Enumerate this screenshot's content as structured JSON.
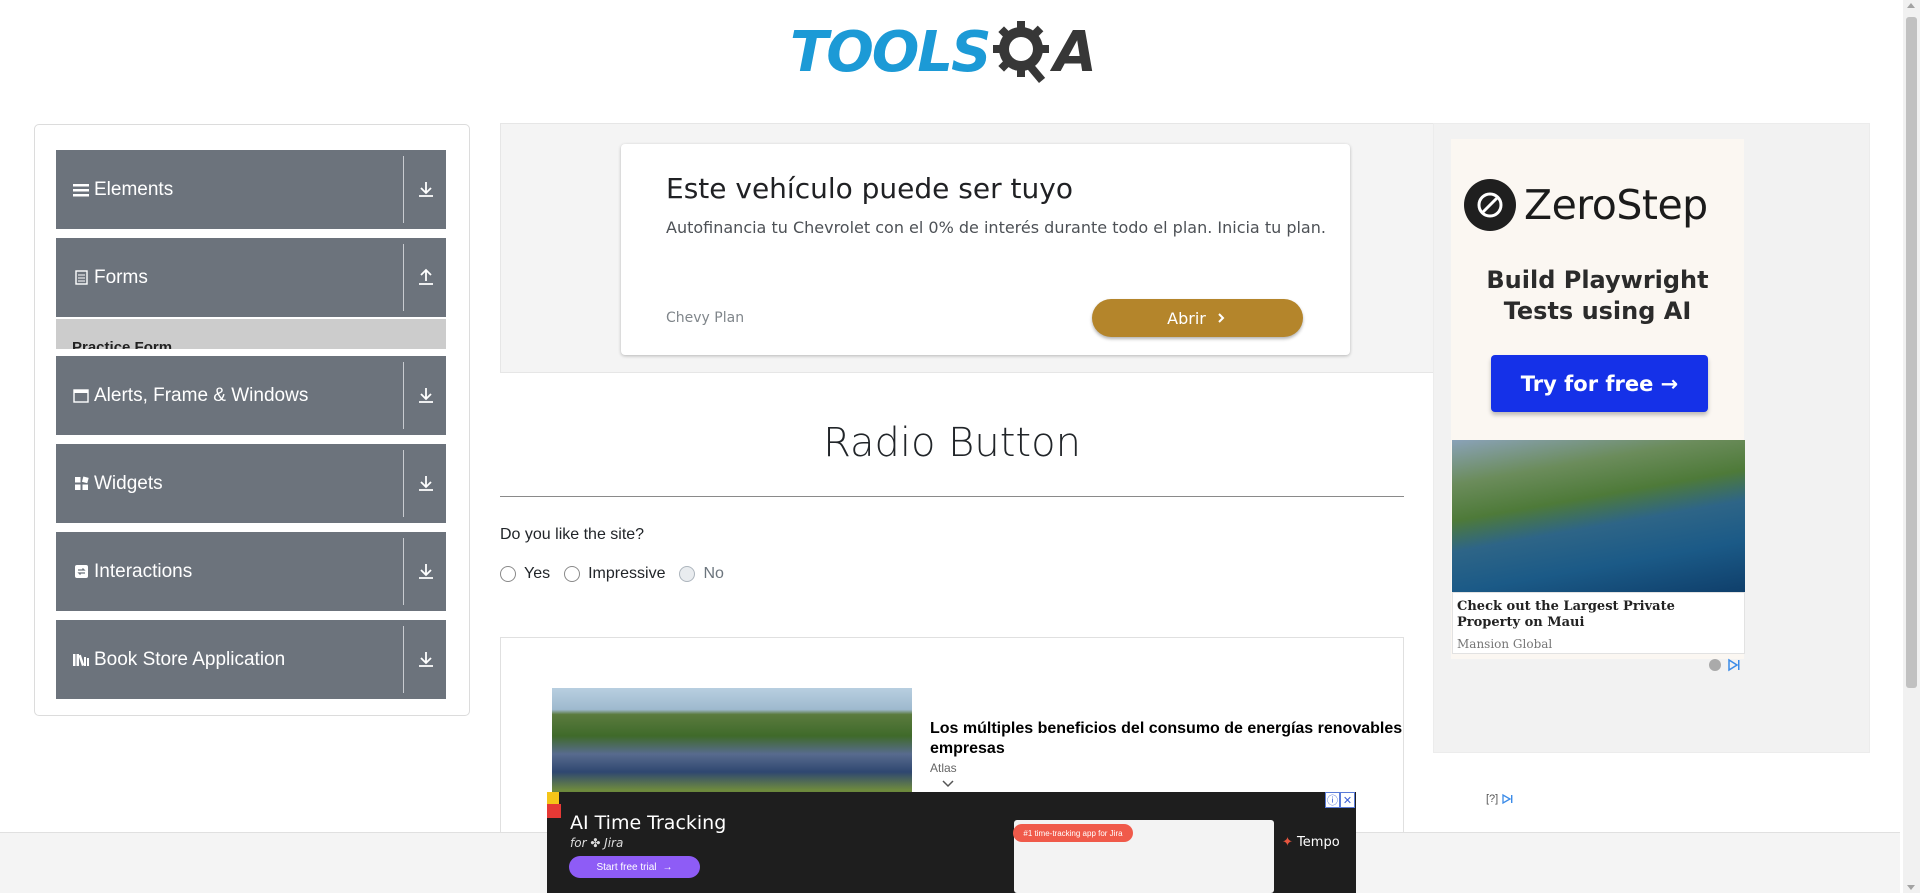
{
  "header": {
    "logo_part1": "TOOLS",
    "logo_part2": "A",
    "logo_icon": "gear-magnifier-icon"
  },
  "sidebar": {
    "groups": [
      {
        "label": "Elements",
        "icon": "menu-icon",
        "arrow": "download-icon"
      },
      {
        "label": "Forms",
        "icon": "form-icon",
        "arrow": "upload-icon"
      },
      {
        "label": "Alerts, Frame & Windows",
        "icon": "window-icon",
        "arrow": "download-icon"
      },
      {
        "label": "Widgets",
        "icon": "widgets-icon",
        "arrow": "download-icon"
      },
      {
        "label": "Interactions",
        "icon": "interactions-icon",
        "arrow": "download-icon"
      },
      {
        "label": "Book Store Application",
        "icon": "books-icon",
        "arrow": "download-icon"
      }
    ],
    "forms_sub_item": "Practice Form"
  },
  "top_ad": {
    "title": "Este vehículo puede ser tuyo",
    "description": "Autofinancia tu Chevrolet con el 0% de interés durante todo el plan. Inicia tu plan.",
    "brand": "Chevy Plan",
    "button": "Abrir"
  },
  "main": {
    "title": "Radio Button",
    "question": "Do you like the site?",
    "options": [
      {
        "label": "Yes",
        "disabled": false
      },
      {
        "label": "Impressive",
        "disabled": false
      },
      {
        "label": "No",
        "disabled": true
      }
    ]
  },
  "native_ad": {
    "title": "Los múltiples beneficios del consumo de energías renovables para las empresas",
    "source": "Atlas",
    "help": "[?]"
  },
  "right_ad": {
    "brand": "ZeroStep",
    "tagline_line1": "Build Playwright",
    "tagline_line2": "Tests using AI",
    "button": "Try for free →",
    "story_title": "Check out the Largest Private Property on Maui",
    "story_source": "Mansion Global"
  },
  "bottom_ad": {
    "title": "AI Time Tracking",
    "subtitle": "for ✤ Jira",
    "button": "Start free trial",
    "badge": "#1 time-tracking app for Jira",
    "brand": "Tempo",
    "close_info": "ⓘ",
    "close_x": "✕"
  },
  "colors": {
    "sidebar_bg": "#6c737c",
    "logo_blue": "#1c9ad6",
    "ad_button": "#b4852b",
    "zerostep_button": "#1531e8"
  }
}
